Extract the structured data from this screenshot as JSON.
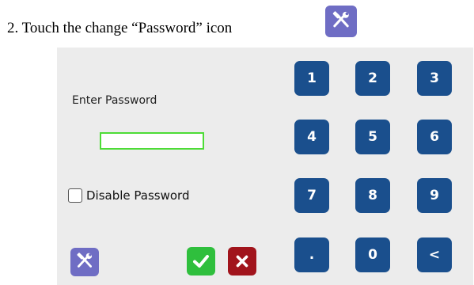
{
  "instruction": {
    "text": "2.  Touch the change “Password” icon",
    "icon": "tools-icon"
  },
  "dialog": {
    "enter_password_label": "Enter Password",
    "password_value": "",
    "disable_password_label": "Disable Password",
    "disable_password_checked": false,
    "colors": {
      "panel_bg": "#ececec",
      "key_bg": "#1a4f8d",
      "tools_bg": "#6f6dc4",
      "ok_bg": "#2fbf3d",
      "cancel_bg": "#a1141c",
      "input_border": "#4ddc36"
    },
    "keypad": {
      "k1": "1",
      "k2": "2",
      "k3": "3",
      "k4": "4",
      "k5": "5",
      "k6": "6",
      "k7": "7",
      "k8": "8",
      "k9": "9",
      "kdot": ".",
      "k0": "0",
      "kback": "<"
    },
    "action_icons": [
      "tools-icon",
      "checkmark-icon",
      "close-icon"
    ]
  }
}
